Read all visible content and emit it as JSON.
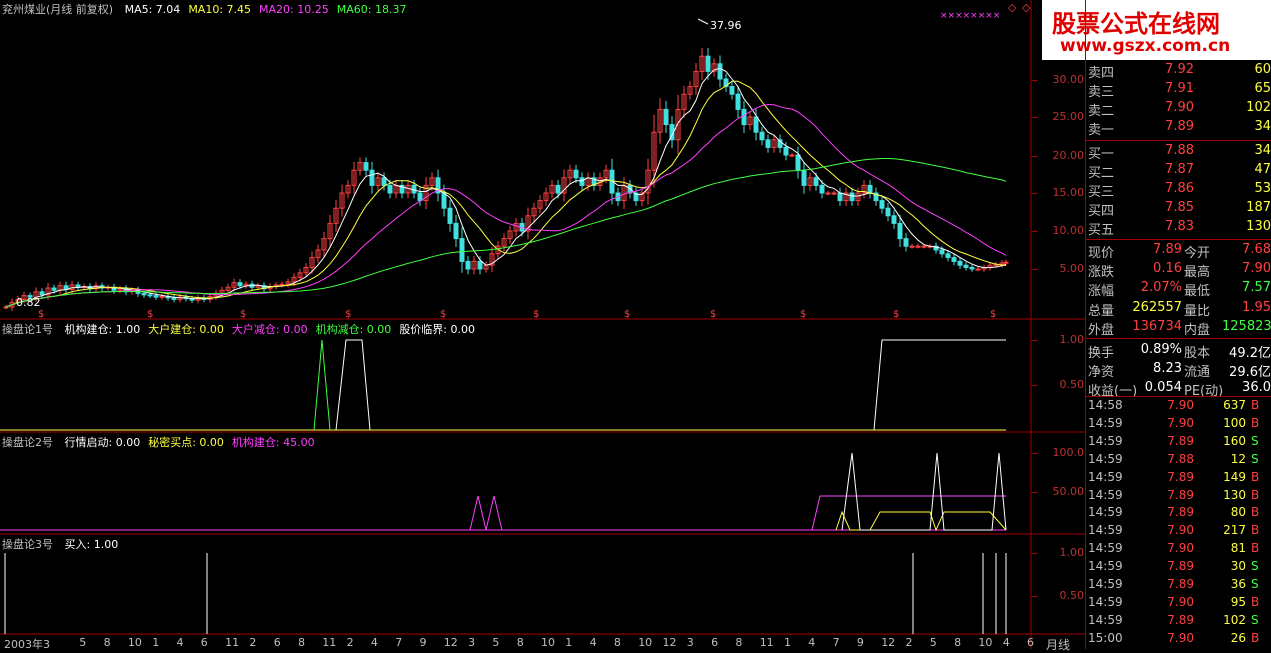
{
  "main": {
    "stock_label": "兖州煤业(月线 前复权)",
    "ma": [
      {
        "label": "MA5: 7.04",
        "color": "#ffffff"
      },
      {
        "label": "MA10: 7.45",
        "color": "#ffff40"
      },
      {
        "label": "MA20: 10.25",
        "color": "#ff40ff"
      },
      {
        "label": "MA60: 18.37",
        "color": "#40ff40"
      }
    ],
    "y_ticks": [
      "30.00",
      "25.00",
      "20.00",
      "15.00",
      "10.00",
      "5.00"
    ],
    "high_marker": "37.96",
    "low_marker": "0.82",
    "x_mark_row": "××××××××",
    "dividend_mark": "$"
  },
  "ind1": {
    "title": "操盘论1号",
    "items": [
      {
        "label": "机构建仓: 1.00",
        "color": "#ffffff"
      },
      {
        "label": "大户建仓: 0.00",
        "color": "#ffff40"
      },
      {
        "label": "大户减仓: 0.00",
        "color": "#ff40ff"
      },
      {
        "label": "机构减仓: 0.00",
        "color": "#40ff40"
      },
      {
        "label": "股价临界: 0.00",
        "color": "#ffffff"
      }
    ],
    "y_ticks": [
      "1.00",
      "0.50"
    ]
  },
  "ind2": {
    "title": "操盘论2号",
    "items": [
      {
        "label": "行情启动: 0.00",
        "color": "#ffffff"
      },
      {
        "label": "秘密买点: 0.00",
        "color": "#ffff40"
      },
      {
        "label": "机构建仓: 45.00",
        "color": "#ff40ff"
      }
    ],
    "y_ticks": [
      "100.0",
      "50.00"
    ]
  },
  "ind3": {
    "title": "操盘论3号",
    "items": [
      {
        "label": "买入: 1.00",
        "color": "#ffffff"
      }
    ],
    "y_ticks": [
      "1.00",
      "0.50"
    ]
  },
  "xaxis": {
    "labels": [
      "2003年3",
      "5",
      "8",
      "10",
      "1",
      "4",
      "6",
      "11",
      "2",
      "6",
      "8",
      "11",
      "2",
      "4",
      "7",
      "9",
      "12",
      "3",
      "5",
      "8",
      "10",
      "1",
      "4",
      "8",
      "10",
      "12",
      "3",
      "6",
      "8",
      "11",
      "1",
      "4",
      "7",
      "9",
      "12",
      "2",
      "5",
      "8",
      "10",
      "4",
      "6"
    ],
    "period": "月线"
  },
  "watermark": {
    "title": "股票公式在线网",
    "url": "www.gszx.com.cn"
  },
  "orderbook": {
    "sell": [
      {
        "label": "卖四",
        "price": "7.92",
        "vol": "60"
      },
      {
        "label": "卖三",
        "price": "7.91",
        "vol": "65"
      },
      {
        "label": "卖二",
        "price": "7.90",
        "vol": "102"
      },
      {
        "label": "卖一",
        "price": "7.89",
        "vol": "34"
      }
    ],
    "buy": [
      {
        "label": "买一",
        "price": "7.88",
        "vol": "34"
      },
      {
        "label": "买二",
        "price": "7.87",
        "vol": "47"
      },
      {
        "label": "买三",
        "price": "7.86",
        "vol": "53"
      },
      {
        "label": "买四",
        "price": "7.85",
        "vol": "187"
      },
      {
        "label": "买五",
        "price": "7.83",
        "vol": "130"
      }
    ]
  },
  "stats": [
    {
      "l1": "现价",
      "v1": "7.89",
      "c1": "#ff4040",
      "l2": "今开",
      "v2": "7.68",
      "c2": "#ff4040"
    },
    {
      "l1": "涨跌",
      "v1": "0.16",
      "c1": "#ff4040",
      "l2": "最高",
      "v2": "7.90",
      "c2": "#ff4040"
    },
    {
      "l1": "涨幅",
      "v1": "2.07%",
      "c1": "#ff4040",
      "l2": "最低",
      "v2": "7.57",
      "c2": "#40ff40"
    },
    {
      "l1": "总量",
      "v1": "262557",
      "c1": "#ffff40",
      "l2": "量比",
      "v2": "1.95",
      "c2": "#ff4040"
    },
    {
      "l1": "外盘",
      "v1": "136734",
      "c1": "#ff4040",
      "l2": "内盘",
      "v2": "125823",
      "c2": "#40ff40"
    },
    {
      "l1": "换手",
      "v1": "0.89%",
      "c1": "#ffffff",
      "l2": "股本",
      "v2": "49.2亿",
      "c2": "#ffffff"
    },
    {
      "l1": "净资",
      "v1": "8.23",
      "c1": "#ffffff",
      "l2": "流通",
      "v2": "29.6亿",
      "c2": "#ffffff"
    },
    {
      "l1": "收益(一)",
      "v1": "0.054",
      "c1": "#ffffff",
      "l2": "PE(动)",
      "v2": "36.0",
      "c2": "#ffffff"
    }
  ],
  "ticks": [
    {
      "time": "14:58",
      "price": "7.90",
      "vol": "637",
      "dir": "B"
    },
    {
      "time": "14:59",
      "price": "7.90",
      "vol": "100",
      "dir": "B"
    },
    {
      "time": "14:59",
      "price": "7.89",
      "vol": "160",
      "dir": "S"
    },
    {
      "time": "14:59",
      "price": "7.88",
      "vol": "12",
      "dir": "S"
    },
    {
      "time": "14:59",
      "price": "7.89",
      "vol": "149",
      "dir": "B"
    },
    {
      "time": "14:59",
      "price": "7.89",
      "vol": "130",
      "dir": "B"
    },
    {
      "time": "14:59",
      "price": "7.89",
      "vol": "80",
      "dir": "B"
    },
    {
      "time": "14:59",
      "price": "7.90",
      "vol": "217",
      "dir": "B"
    },
    {
      "time": "14:59",
      "price": "7.90",
      "vol": "81",
      "dir": "B"
    },
    {
      "time": "14:59",
      "price": "7.89",
      "vol": "30",
      "dir": "S"
    },
    {
      "time": "14:59",
      "price": "7.89",
      "vol": "36",
      "dir": "S"
    },
    {
      "time": "14:59",
      "price": "7.90",
      "vol": "95",
      "dir": "B"
    },
    {
      "time": "14:59",
      "price": "7.89",
      "vol": "102",
      "dir": "S"
    },
    {
      "time": "15:00",
      "price": "7.90",
      "vol": "26",
      "dir": "B"
    }
  ]
}
